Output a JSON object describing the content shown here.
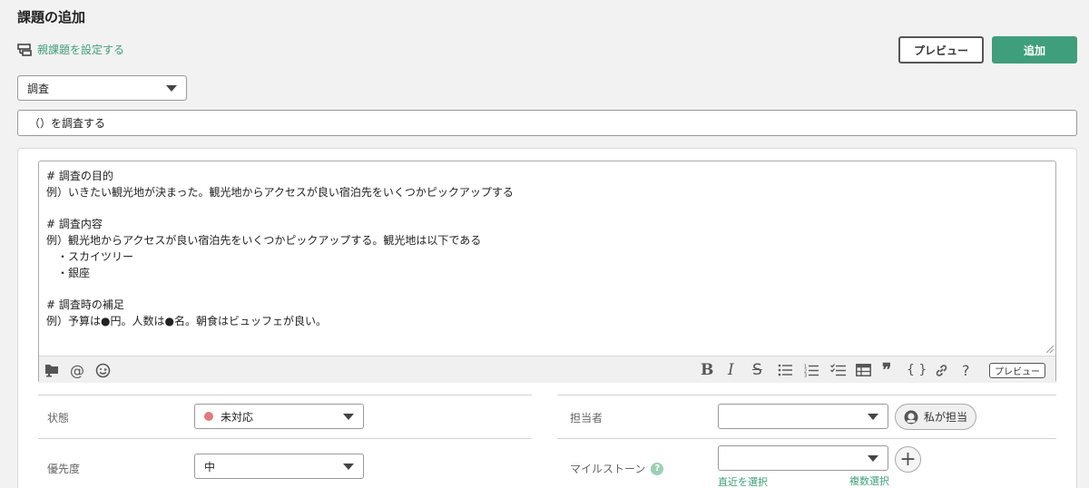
{
  "page": {
    "title": "課題の追加",
    "parent_link": "親課題を設定する",
    "preview_button": "プレビュー",
    "add_button": "追加"
  },
  "form": {
    "issue_type": "調査",
    "summary": "（）を調査する",
    "description_lines": [
      "# 調査の目的",
      "例）いきたい観光地が決まった。観光地からアクセスが良い宿泊先をいくつかピックアップする",
      "",
      "# 調査内容",
      "例）観光地からアクセスが良い宿泊先をいくつかピックアップする。観光地は以下である",
      "　・スカイツリー",
      "　・銀座",
      "",
      "# 調査時の補足",
      "例）予算は●円。人数は●名。朝食はビュッフェが良い。"
    ],
    "toolbar": {
      "icons": [
        "folder-icon",
        "mention-icon",
        "emoji-icon",
        "bold-icon",
        "italic-icon",
        "strikethrough-icon",
        "bullet-list-icon",
        "numbered-list-icon",
        "checklist-icon",
        "table-icon",
        "quote-icon",
        "code-icon",
        "link-icon",
        "help-icon"
      ],
      "preview_label": "プレビュー"
    }
  },
  "fields": {
    "status_label": "状態",
    "status_value": "未対応",
    "status_color": "#e07b7b",
    "priority_label": "優先度",
    "priority_value": "中",
    "assignee_label": "担当者",
    "assignee_value": "",
    "assign_me_label": "私が担当",
    "milestone_label": "マイルストーン",
    "milestone_value": "",
    "recent_link": "直近を選択",
    "multi_link": "複数選択"
  },
  "colors": {
    "accent": "#3f9e7b",
    "background": "#f2f2f2"
  }
}
